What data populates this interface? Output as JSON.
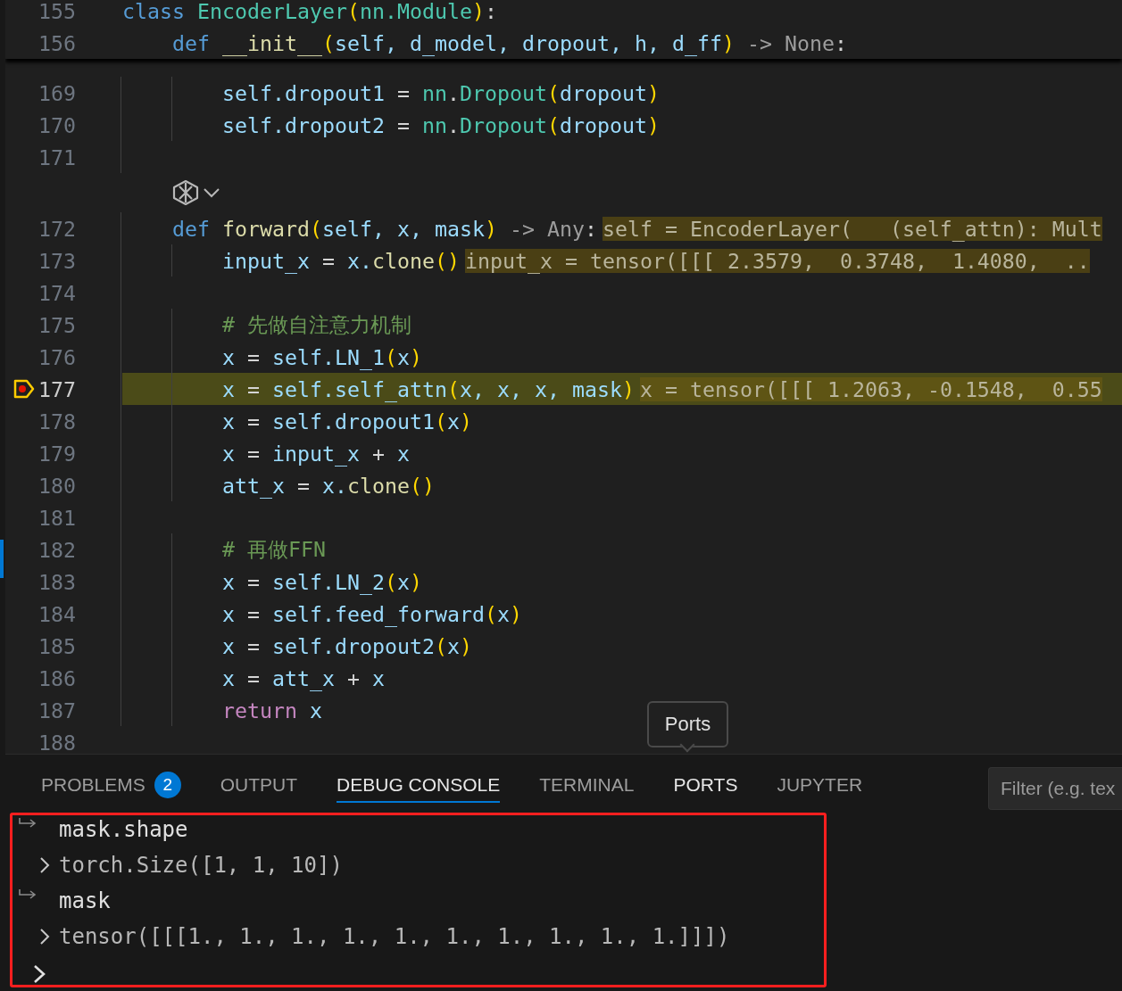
{
  "sticky_lines": [
    {
      "number": "155",
      "tokens": [
        {
          "t": "class ",
          "kind": "kw"
        },
        {
          "t": "EncoderLayer",
          "kind": "cls"
        },
        {
          "t": "(",
          "kind": "b"
        },
        {
          "t": "nn.Module",
          "kind": "cls"
        },
        {
          "t": ")",
          "kind": "b"
        },
        {
          "t": ":",
          "kind": "p"
        }
      ]
    },
    {
      "number": "156",
      "tokens": [
        {
          "t": "    def ",
          "kind": "kw"
        },
        {
          "t": "__init__",
          "kind": "fn"
        },
        {
          "t": "(",
          "kind": "b"
        },
        {
          "t": "self, d_model, dropout, h, d_ff",
          "kind": "v"
        },
        {
          "t": ")",
          "kind": "b"
        },
        {
          "t": " -> None",
          "kind": "hint"
        },
        {
          "t": ":",
          "kind": "p"
        }
      ]
    }
  ],
  "lines": [
    {
      "kind": "code",
      "number": "169",
      "current": false,
      "breakpoint": false,
      "tokens": [
        {
          "t": "        self.dropout1",
          "kind": "v"
        },
        {
          "t": " = ",
          "kind": "p"
        },
        {
          "t": "nn",
          "kind": "cls"
        },
        {
          "t": ".",
          "kind": "p"
        },
        {
          "t": "Dropout",
          "kind": "cls"
        },
        {
          "t": "(",
          "kind": "b"
        },
        {
          "t": "dropout",
          "kind": "v"
        },
        {
          "t": ")",
          "kind": "b"
        }
      ]
    },
    {
      "kind": "code",
      "number": "170",
      "current": false,
      "breakpoint": false,
      "tokens": [
        {
          "t": "        self.dropout2",
          "kind": "v"
        },
        {
          "t": " = ",
          "kind": "p"
        },
        {
          "t": "nn",
          "kind": "cls"
        },
        {
          "t": ".",
          "kind": "p"
        },
        {
          "t": "Dropout",
          "kind": "cls"
        },
        {
          "t": "(",
          "kind": "b"
        },
        {
          "t": "dropout",
          "kind": "v"
        },
        {
          "t": ")",
          "kind": "b"
        }
      ]
    },
    {
      "kind": "code",
      "number": "171",
      "current": false,
      "breakpoint": false
    },
    {
      "kind": "codelens"
    },
    {
      "kind": "code",
      "number": "172",
      "current": false,
      "breakpoint": false,
      "tokens": [
        {
          "t": "    def ",
          "kind": "kw"
        },
        {
          "t": "forward",
          "kind": "fn"
        },
        {
          "t": "(",
          "kind": "b"
        },
        {
          "t": "self, x, mask",
          "kind": "v"
        },
        {
          "t": ")",
          "kind": "b"
        },
        {
          "t": " -> Any",
          "kind": "hint"
        },
        {
          "t": ":",
          "kind": "p"
        }
      ],
      "inline": "self = EncoderLayer(   (self_attn): Mult"
    },
    {
      "kind": "code",
      "number": "173",
      "current": false,
      "breakpoint": false,
      "tokens": [
        {
          "t": "        input_x",
          "kind": "v"
        },
        {
          "t": " = ",
          "kind": "p"
        },
        {
          "t": "x.",
          "kind": "v"
        },
        {
          "t": "clone",
          "kind": "fn"
        },
        {
          "t": "()",
          "kind": "b"
        }
      ],
      "inline": "input_x = tensor([[[ 2.3579,  0.3748,  1.4080,  .."
    },
    {
      "kind": "code",
      "number": "174",
      "current": false,
      "breakpoint": false
    },
    {
      "kind": "code",
      "number": "175",
      "current": false,
      "breakpoint": false,
      "tokens": [
        {
          "t": "        # 先做自注意力机制",
          "kind": "c"
        }
      ]
    },
    {
      "kind": "code",
      "number": "176",
      "current": false,
      "breakpoint": false,
      "tokens": [
        {
          "t": "        x",
          "kind": "v"
        },
        {
          "t": " = ",
          "kind": "p"
        },
        {
          "t": "self.LN_1",
          "kind": "v"
        },
        {
          "t": "(",
          "kind": "b"
        },
        {
          "t": "x",
          "kind": "v"
        },
        {
          "t": ")",
          "kind": "b"
        }
      ]
    },
    {
      "kind": "code",
      "number": "177",
      "current": true,
      "breakpoint": true,
      "tokens": [
        {
          "t": "        x",
          "kind": "v"
        },
        {
          "t": " = ",
          "kind": "p"
        },
        {
          "t": "self.self_attn",
          "kind": "v"
        },
        {
          "t": "(",
          "kind": "b"
        },
        {
          "t": "x, x, x, mask",
          "kind": "v"
        },
        {
          "t": ")",
          "kind": "b"
        }
      ],
      "inline": "x = tensor([[[ 1.2063, -0.1548,  0.55"
    },
    {
      "kind": "code",
      "number": "178",
      "current": false,
      "breakpoint": false,
      "tokens": [
        {
          "t": "        x",
          "kind": "v"
        },
        {
          "t": " = ",
          "kind": "p"
        },
        {
          "t": "self.dropout1",
          "kind": "v"
        },
        {
          "t": "(",
          "kind": "b"
        },
        {
          "t": "x",
          "kind": "v"
        },
        {
          "t": ")",
          "kind": "b"
        }
      ]
    },
    {
      "kind": "code",
      "number": "179",
      "current": false,
      "breakpoint": false,
      "tokens": [
        {
          "t": "        x",
          "kind": "v"
        },
        {
          "t": " = ",
          "kind": "p"
        },
        {
          "t": "input_x",
          "kind": "v"
        },
        {
          "t": " + ",
          "kind": "p"
        },
        {
          "t": "x",
          "kind": "v"
        }
      ]
    },
    {
      "kind": "code",
      "number": "180",
      "current": false,
      "breakpoint": false,
      "tokens": [
        {
          "t": "        att_x",
          "kind": "v"
        },
        {
          "t": " = ",
          "kind": "p"
        },
        {
          "t": "x.",
          "kind": "v"
        },
        {
          "t": "clone",
          "kind": "fn"
        },
        {
          "t": "()",
          "kind": "b"
        }
      ]
    },
    {
      "kind": "code",
      "number": "181",
      "current": false,
      "breakpoint": false
    },
    {
      "kind": "code",
      "number": "182",
      "current": false,
      "breakpoint": false,
      "tokens": [
        {
          "t": "        # 再做FFN",
          "kind": "c"
        }
      ]
    },
    {
      "kind": "code",
      "number": "183",
      "current": false,
      "breakpoint": false,
      "tokens": [
        {
          "t": "        x",
          "kind": "v"
        },
        {
          "t": " = ",
          "kind": "p"
        },
        {
          "t": "self.LN_2",
          "kind": "v"
        },
        {
          "t": "(",
          "kind": "b"
        },
        {
          "t": "x",
          "kind": "v"
        },
        {
          "t": ")",
          "kind": "b"
        }
      ]
    },
    {
      "kind": "code",
      "number": "184",
      "current": false,
      "breakpoint": false,
      "tokens": [
        {
          "t": "        x",
          "kind": "v"
        },
        {
          "t": " = ",
          "kind": "p"
        },
        {
          "t": "self.feed_forward",
          "kind": "v"
        },
        {
          "t": "(",
          "kind": "b"
        },
        {
          "t": "x",
          "kind": "v"
        },
        {
          "t": ")",
          "kind": "b"
        }
      ]
    },
    {
      "kind": "code",
      "number": "185",
      "current": false,
      "breakpoint": false,
      "tokens": [
        {
          "t": "        x",
          "kind": "v"
        },
        {
          "t": " = ",
          "kind": "p"
        },
        {
          "t": "self.dropout2",
          "kind": "v"
        },
        {
          "t": "(",
          "kind": "b"
        },
        {
          "t": "x",
          "kind": "v"
        },
        {
          "t": ")",
          "kind": "b"
        }
      ]
    },
    {
      "kind": "code",
      "number": "186",
      "current": false,
      "breakpoint": false,
      "tokens": [
        {
          "t": "        x",
          "kind": "v"
        },
        {
          "t": " = ",
          "kind": "p"
        },
        {
          "t": "att_x",
          "kind": "v"
        },
        {
          "t": " + ",
          "kind": "p"
        },
        {
          "t": "x",
          "kind": "v"
        }
      ]
    },
    {
      "kind": "code",
      "number": "187",
      "current": false,
      "breakpoint": false,
      "tokens": [
        {
          "t": "        return ",
          "kind": "ctl"
        },
        {
          "t": "x",
          "kind": "v"
        }
      ]
    },
    {
      "kind": "code",
      "number": "188",
      "current": false,
      "breakpoint": false
    }
  ],
  "tooltip": "Ports",
  "panel_tabs": [
    {
      "label": "PROBLEMS",
      "badge": "2",
      "selected": false,
      "hovered": false
    },
    {
      "label": "OUTPUT",
      "selected": false,
      "hovered": false
    },
    {
      "label": "DEBUG CONSOLE",
      "selected": true,
      "hovered": false
    },
    {
      "label": "TERMINAL",
      "selected": false,
      "hovered": false
    },
    {
      "label": "PORTS",
      "selected": false,
      "hovered": true
    },
    {
      "label": "JUPYTER",
      "selected": false,
      "hovered": false
    }
  ],
  "filter": {
    "placeholder": "Filter (e.g. tex"
  },
  "console": [
    {
      "kind": "input",
      "text": "mask.shape"
    },
    {
      "kind": "output",
      "text": "torch.Size([1, 1, 10])"
    },
    {
      "kind": "input",
      "text": "mask"
    },
    {
      "kind": "output",
      "text": "tensor([[[1., 1., 1., 1., 1., 1., 1., 1., 1., 1.]]])"
    }
  ]
}
